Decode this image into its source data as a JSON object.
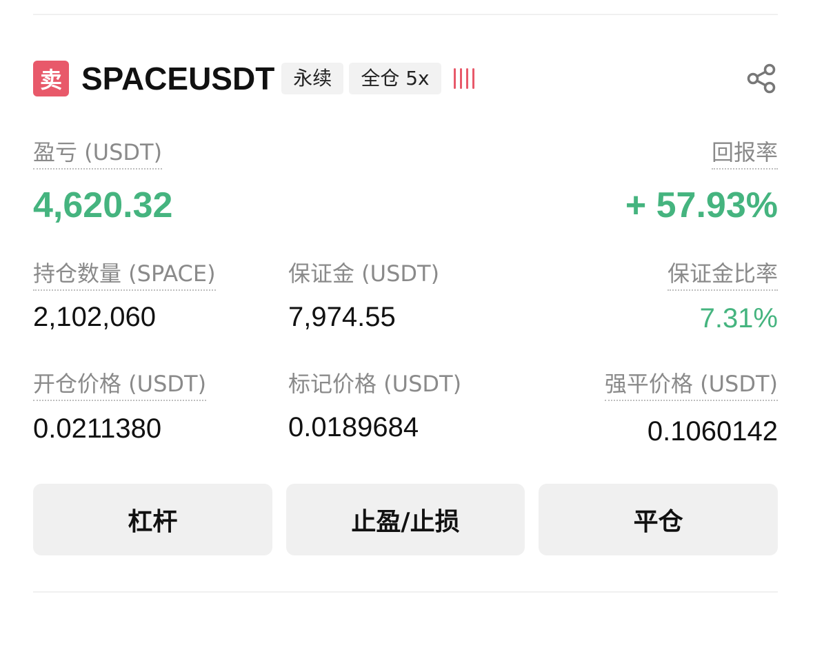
{
  "position": {
    "side_label": "卖",
    "symbol": "SPACEUSDT",
    "contract_type": "永续",
    "margin_mode": "全仓 5x"
  },
  "pnl": {
    "label": "盈亏 (USDT)",
    "value": "4,620.32"
  },
  "roe": {
    "label": "回报率",
    "value": "+ 57.93%"
  },
  "size": {
    "label": "持仓数量 (SPACE)",
    "value": "2,102,060"
  },
  "margin": {
    "label": "保证金 (USDT)",
    "value": "7,974.55"
  },
  "margin_ratio": {
    "label": "保证金比率",
    "value": "7.31%"
  },
  "entry_price": {
    "label": "开仓价格 (USDT)",
    "value": "0.0211380"
  },
  "mark_price": {
    "label": "标记价格 (USDT)",
    "value": "0.0189684"
  },
  "liq_price": {
    "label": "强平价格 (USDT)",
    "value": "0.1060142"
  },
  "actions": {
    "leverage": "杠杆",
    "tp_sl": "止盈/止损",
    "close": "平仓"
  },
  "colors": {
    "profit_green": "#45b47f",
    "sell_red": "#e8596a"
  },
  "icons": {
    "share": "share-icon",
    "risk": "risk-warning-icon"
  }
}
